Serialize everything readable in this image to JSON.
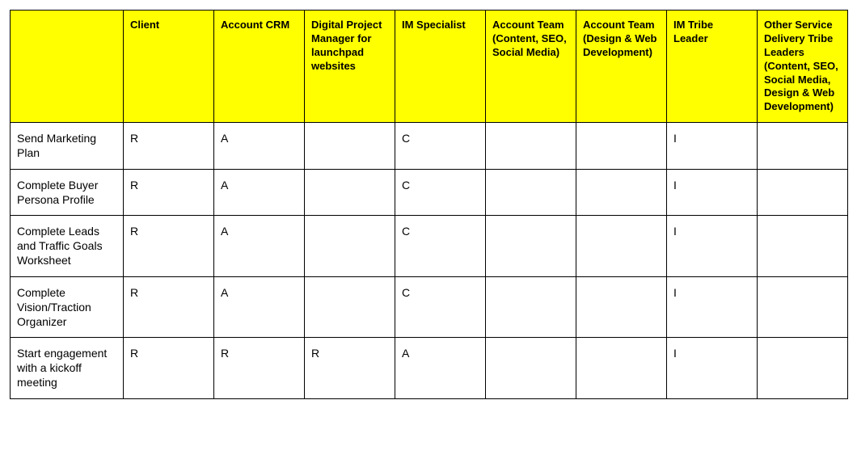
{
  "columns": [
    "",
    "Client",
    "Account CRM",
    "Digital Project Manager for launchpad websites",
    "IM Specialist",
    "Account Team (Content, SEO, Social Media)",
    "Account Team (Design & Web Development)",
    "IM Tribe Leader",
    "Other Service Delivery Tribe Leaders (Content, SEO, Social Media, Design & Web Development)"
  ],
  "rows": [
    {
      "task": "Send Marketing Plan",
      "cells": [
        "R",
        "A",
        "",
        "C",
        "",
        "",
        "I",
        ""
      ]
    },
    {
      "task": "Complete Buyer Persona Profile",
      "cells": [
        "R",
        "A",
        "",
        "C",
        "",
        "",
        "I",
        ""
      ]
    },
    {
      "task": "Complete Leads and Traffic Goals Worksheet",
      "cells": [
        "R",
        "A",
        "",
        "C",
        "",
        "",
        "I",
        ""
      ]
    },
    {
      "task": "Complete Vision/Traction Organizer",
      "cells": [
        "R",
        "A",
        "",
        "C",
        "",
        "",
        "I",
        ""
      ]
    },
    {
      "task": "Start engagement with a kickoff meeting",
      "cells": [
        "R",
        "R",
        "R",
        "A",
        "",
        "",
        "I",
        ""
      ]
    }
  ]
}
